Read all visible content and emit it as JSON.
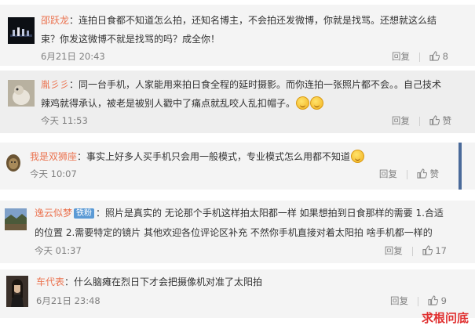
{
  "comments": [
    {
      "username": "邵跃龙",
      "sep": "：",
      "line1": "连拍日食都不知道怎么拍，还知名博主，不会拍还发微博，你就是找骂。还想就这么结",
      "line2": "束？你发这微博不就是找骂的吗？成全你！",
      "time": "6月21日 20:43",
      "reply": "回复",
      "likes": "8"
    },
    {
      "username": "胤彡彡",
      "sep": "：",
      "line1": "同一台手机，人家能用来拍日食全程的延时摄影。而你连拍一张照片都不会。。自己技术",
      "line2": "辣鸡就得承认，被老是被别人戳中了痛点就乱咬人乱扣帽子。",
      "time": "今天 11:53",
      "reply": "回复",
      "likes": "赞"
    },
    {
      "username": "我是双狮座",
      "sep": "：",
      "line1": "事实上好多人买手机只会用一般模式，专业模式怎么用都不知道",
      "time": "今天 10:07",
      "reply": "回复",
      "likes": "赞"
    },
    {
      "username": "逸云似梦",
      "badge": "铁粉",
      "line1": "照片是真实的  无论那个手机这样拍太阳都一样  如果想拍到日食那样的需要 1.合适",
      "line2": "的位置    2.需要特定的镜片 其他欢迎各位评论区补充  不然你手机直接对着太阳拍  啥手机都一样的",
      "time": "今天 01:37",
      "reply": "回复",
      "likes": "17"
    },
    {
      "username": "车代表",
      "sep": "：",
      "line1": "什么脑瘫在烈日下才会把摄像机对准了太阳拍",
      "time": "6月21日 23:48",
      "reply": "回复",
      "likes": "9"
    }
  ],
  "watermark": "求根问底",
  "icons": {
    "like": "thumbs-up-icon"
  },
  "colors": {
    "username": "#eb7350",
    "badge": "#5b9ad5",
    "watermark": "#e03030"
  }
}
